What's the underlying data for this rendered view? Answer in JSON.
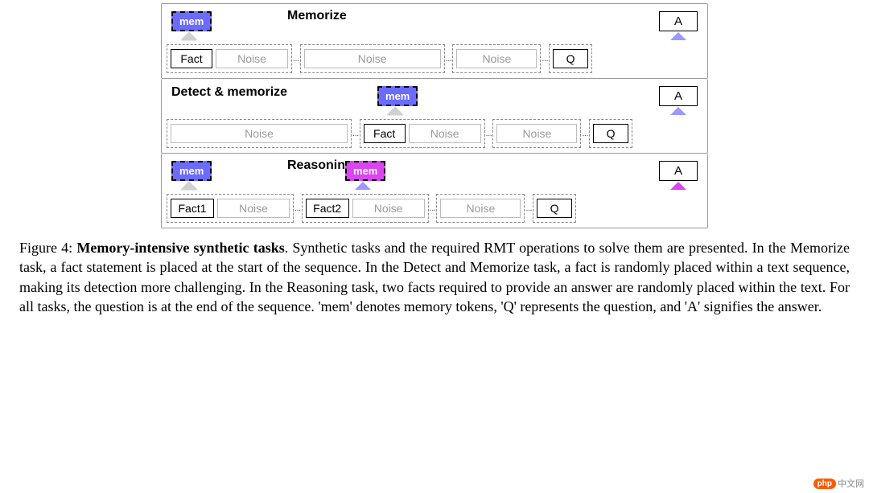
{
  "panels": {
    "memorize": {
      "title": "Memorize",
      "mem": "mem",
      "answer": "A",
      "fact": "Fact",
      "noise": "Noise",
      "q": "Q"
    },
    "detect": {
      "title": "Detect & memorize",
      "mem": "mem",
      "answer": "A",
      "fact": "Fact",
      "noise": "Noise",
      "q": "Q"
    },
    "reasoning": {
      "title": "Reasoning",
      "mem1": "mem",
      "mem2": "mem",
      "answer": "A",
      "fact1": "Fact1",
      "fact2": "Fact2",
      "noise": "Noise",
      "q": "Q"
    }
  },
  "dots": "...",
  "caption": {
    "label": "Figure 4:",
    "title": "Memory-intensive synthetic tasks",
    "body": ". Synthetic tasks and the required RMT operations to solve them are presented. In the Memorize task, a fact statement is placed at the start of the sequence. In the Detect and Memorize task, a fact is randomly placed within a text sequence, making its detection more challenging. In the Reasoning task, two facts required to provide an answer are randomly placed within the text. For all tasks, the question is at the end of the sequence. 'mem' denotes memory tokens, 'Q' represents the question, and 'A' signifies the answer."
  },
  "watermark": {
    "logo": "php",
    "text": "中文网"
  }
}
